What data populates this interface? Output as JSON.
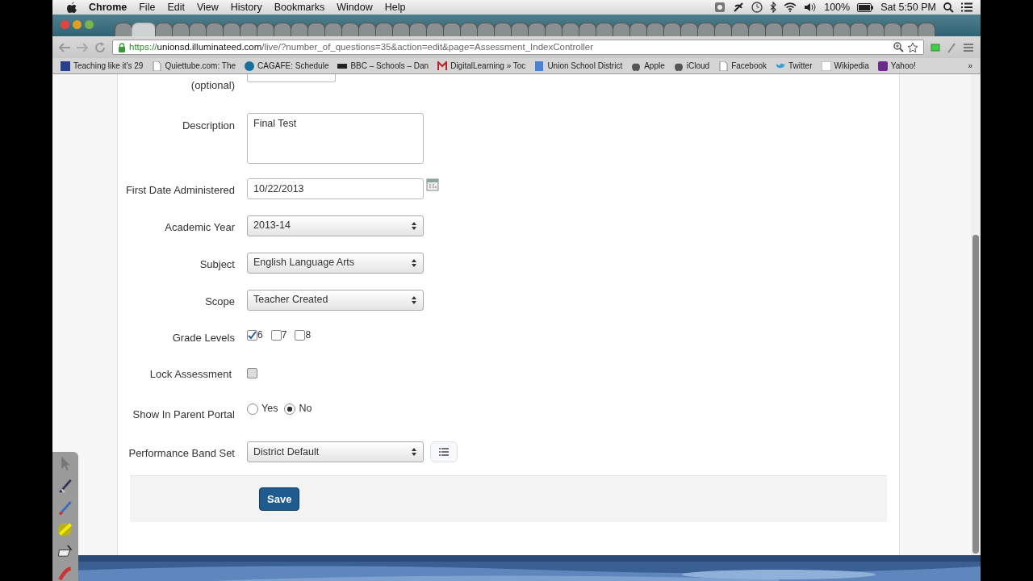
{
  "menubar": {
    "app": "Chrome",
    "menus": [
      "File",
      "Edit",
      "View",
      "History",
      "Bookmarks",
      "Window",
      "Help"
    ],
    "battery": "100%",
    "clock": "Sat 5:50 PM"
  },
  "tabs": [
    {
      "selected": false
    },
    {
      "selected": true
    },
    {
      "selected": false
    },
    {
      "selected": false
    },
    {
      "selected": false
    },
    {
      "selected": false
    },
    {
      "selected": false
    },
    {
      "selected": false
    },
    {
      "selected": false
    },
    {
      "selected": false
    },
    {
      "selected": false
    },
    {
      "selected": false
    },
    {
      "selected": false
    },
    {
      "selected": false
    },
    {
      "selected": false
    },
    {
      "selected": false
    },
    {
      "selected": false
    },
    {
      "selected": false
    },
    {
      "selected": false
    },
    {
      "selected": false
    },
    {
      "selected": false
    },
    {
      "selected": false
    },
    {
      "selected": false
    },
    {
      "selected": false
    },
    {
      "selected": false
    },
    {
      "selected": false
    },
    {
      "selected": false
    },
    {
      "selected": false
    },
    {
      "selected": false
    },
    {
      "selected": false
    },
    {
      "selected": false
    },
    {
      "selected": false
    },
    {
      "selected": false
    },
    {
      "selected": false
    },
    {
      "selected": false
    },
    {
      "selected": false
    },
    {
      "selected": false
    },
    {
      "selected": false
    },
    {
      "selected": false
    },
    {
      "selected": false
    },
    {
      "selected": false
    },
    {
      "selected": false
    },
    {
      "selected": false
    },
    {
      "selected": false
    },
    {
      "selected": false
    },
    {
      "selected": false
    },
    {
      "selected": false
    },
    {
      "selected": false
    }
  ],
  "address": {
    "scheme": "https://",
    "host": "unionsd.illuminateed.com",
    "path": "/live/?number_of_questions=35&action=edit&page=Assessment_IndexController"
  },
  "bookmarks": [
    "Teaching like it's 29",
    "Quiettube.com: The",
    "CAGAFE: Schedule",
    "BBC – Schools – Dan",
    "DigitalLearning » Toc",
    "Union School District",
    "Apple",
    "iCloud",
    "Facebook",
    "Twitter",
    "Wikipedia",
    "Yahoo!"
  ],
  "bookmarks_overflow": "»",
  "form": [
    {
      "kind": "text",
      "label": "(optional)"
    },
    {
      "kind": "textarea",
      "label": "Description",
      "value": "Final Test"
    },
    {
      "kind": "date",
      "label": "First Date Administered",
      "value": "10/22/2013"
    },
    {
      "kind": "select",
      "label": "Academic Year",
      "value": "2013-14"
    },
    {
      "kind": "select",
      "label": "Subject",
      "value": "English Language Arts"
    },
    {
      "kind": "select",
      "label": "Scope",
      "value": "Teacher Created"
    },
    {
      "kind": "checkboxes",
      "label": "Grade Levels",
      "options": [
        {
          "label": "6",
          "checked": true
        },
        {
          "label": "7",
          "checked": false
        },
        {
          "label": "8",
          "checked": false
        }
      ]
    },
    {
      "kind": "checkbox",
      "label": "Lock Assessment",
      "checked": false
    },
    {
      "kind": "radios",
      "label": "Show In Parent Portal",
      "options": [
        {
          "label": "Yes",
          "selected": false
        },
        {
          "label": "No",
          "selected": true
        }
      ]
    },
    {
      "kind": "select_list",
      "label": "Performance Band Set",
      "value": "District Default"
    }
  ],
  "save_button": "Save"
}
